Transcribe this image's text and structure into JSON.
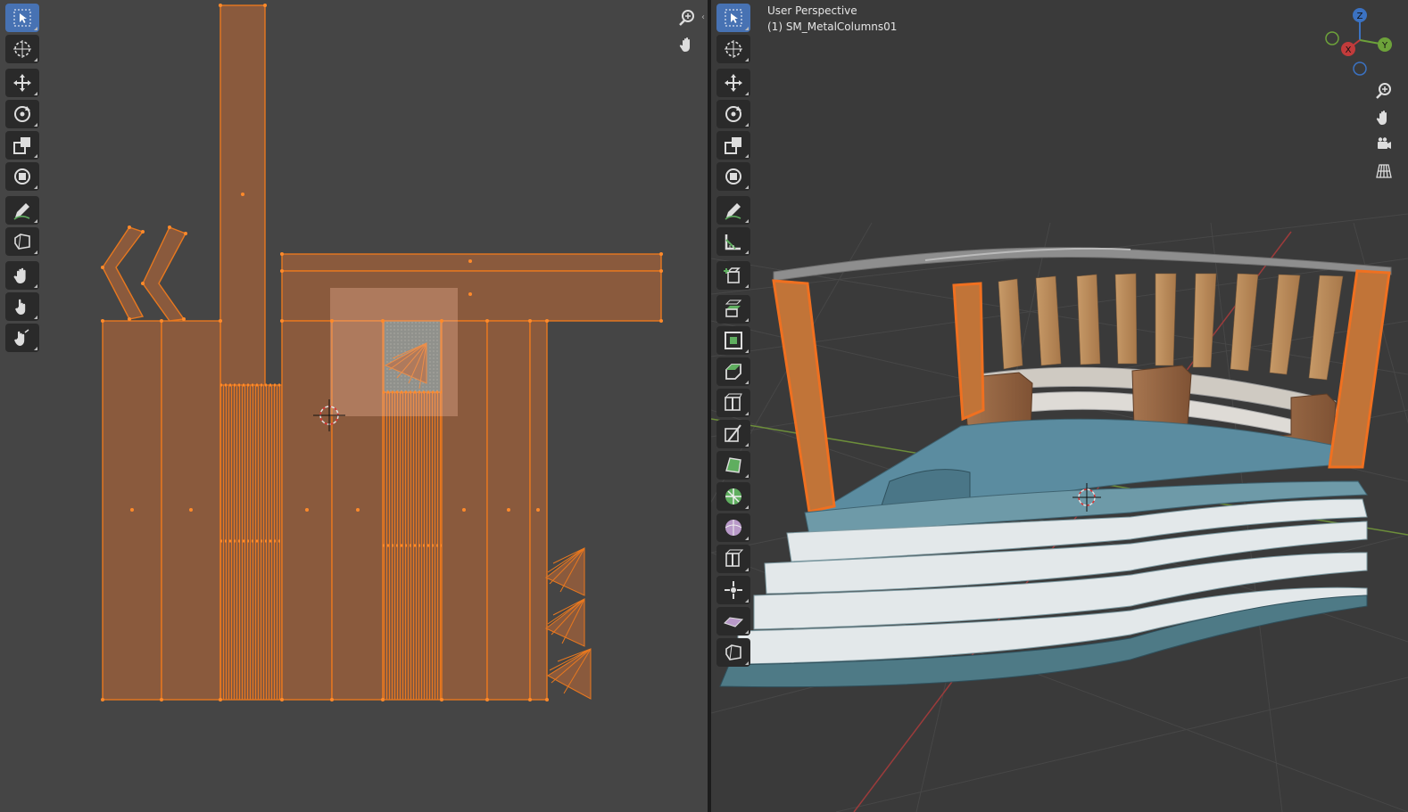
{
  "uv_editor": {
    "toolbar": [
      {
        "name": "select-box-tool",
        "icon": "select-box-icon",
        "active": true
      },
      {
        "name": "cursor-tool",
        "icon": "cursor-icon"
      },
      {
        "name": "move-tool",
        "icon": "move-icon",
        "gap": true
      },
      {
        "name": "rotate-tool",
        "icon": "rotate-icon"
      },
      {
        "name": "scale-tool",
        "icon": "scale-icon"
      },
      {
        "name": "transform-tool",
        "icon": "transform-icon"
      },
      {
        "name": "annotate-tool",
        "icon": "annotate-icon",
        "gap": true
      },
      {
        "name": "rip-region-tool",
        "icon": "rip-icon"
      },
      {
        "name": "grab-brush-tool",
        "icon": "grab-hand-icon",
        "gap": true
      },
      {
        "name": "relax-brush-tool",
        "icon": "relax-hand-icon"
      },
      {
        "name": "pinch-brush-tool",
        "icon": "pinch-hand-icon"
      }
    ],
    "nav": [
      {
        "name": "uv-zoom-button",
        "icon": "zoom-icon"
      },
      {
        "name": "uv-pan-button",
        "icon": "pan-hand-icon"
      }
    ],
    "colors": {
      "island_fill": "#8a5a3d",
      "edge": "#e8781f",
      "vertex": "#ff8a2a",
      "selection": "#f0b89a"
    }
  },
  "viewport": {
    "header": {
      "line1": "User Perspective",
      "line2": "(1) SM_MetalColumns01"
    },
    "toolbar": [
      {
        "name": "select-box-tool",
        "icon": "select-box-icon",
        "active": true
      },
      {
        "name": "cursor-tool",
        "icon": "cursor-icon"
      },
      {
        "name": "move-tool",
        "icon": "move-icon",
        "gap": true
      },
      {
        "name": "rotate-tool",
        "icon": "rotate-icon"
      },
      {
        "name": "scale-tool",
        "icon": "scale-icon"
      },
      {
        "name": "transform-tool",
        "icon": "transform-icon"
      },
      {
        "name": "annotate-tool",
        "icon": "annotate-icon",
        "gap": true
      },
      {
        "name": "measure-tool",
        "icon": "measure-icon"
      },
      {
        "name": "add-cube-tool",
        "icon": "add-cube-icon",
        "gap": true
      },
      {
        "name": "extrude-tool",
        "icon": "extrude-icon",
        "gap": true
      },
      {
        "name": "inset-tool",
        "icon": "inset-icon"
      },
      {
        "name": "bevel-tool",
        "icon": "bevel-icon"
      },
      {
        "name": "loop-cut-tool",
        "icon": "loop-cut-icon"
      },
      {
        "name": "knife-tool",
        "icon": "knife-icon"
      },
      {
        "name": "poly-build-tool",
        "icon": "poly-build-icon"
      },
      {
        "name": "spin-tool",
        "icon": "spin-icon"
      },
      {
        "name": "smooth-tool",
        "icon": "smooth-icon"
      },
      {
        "name": "edge-slide-tool",
        "icon": "edge-slide-icon"
      },
      {
        "name": "shrink-fatten-tool",
        "icon": "shrink-fatten-icon"
      },
      {
        "name": "shear-tool",
        "icon": "shear-icon"
      },
      {
        "name": "rip-tool",
        "icon": "rip-icon"
      }
    ],
    "gizmo": {
      "z": "Z",
      "y": "Y",
      "x": "X"
    },
    "nav": [
      {
        "name": "vp-zoom-button",
        "icon": "zoom-icon"
      },
      {
        "name": "vp-pan-button",
        "icon": "pan-hand-icon"
      },
      {
        "name": "camera-view-button",
        "icon": "camera-icon"
      },
      {
        "name": "ortho-toggle-button",
        "icon": "grid-icon"
      }
    ],
    "colors": {
      "grid": "#4a4a4a",
      "axis_x": "#9c3b3b",
      "axis_y": "#6d8e3a",
      "selected_outline": "#f07020",
      "water": "#5b8ca0",
      "wood": "#b88a5c",
      "steps_white": "#e3e8ea",
      "steps_teal": "#4e7a86"
    }
  }
}
